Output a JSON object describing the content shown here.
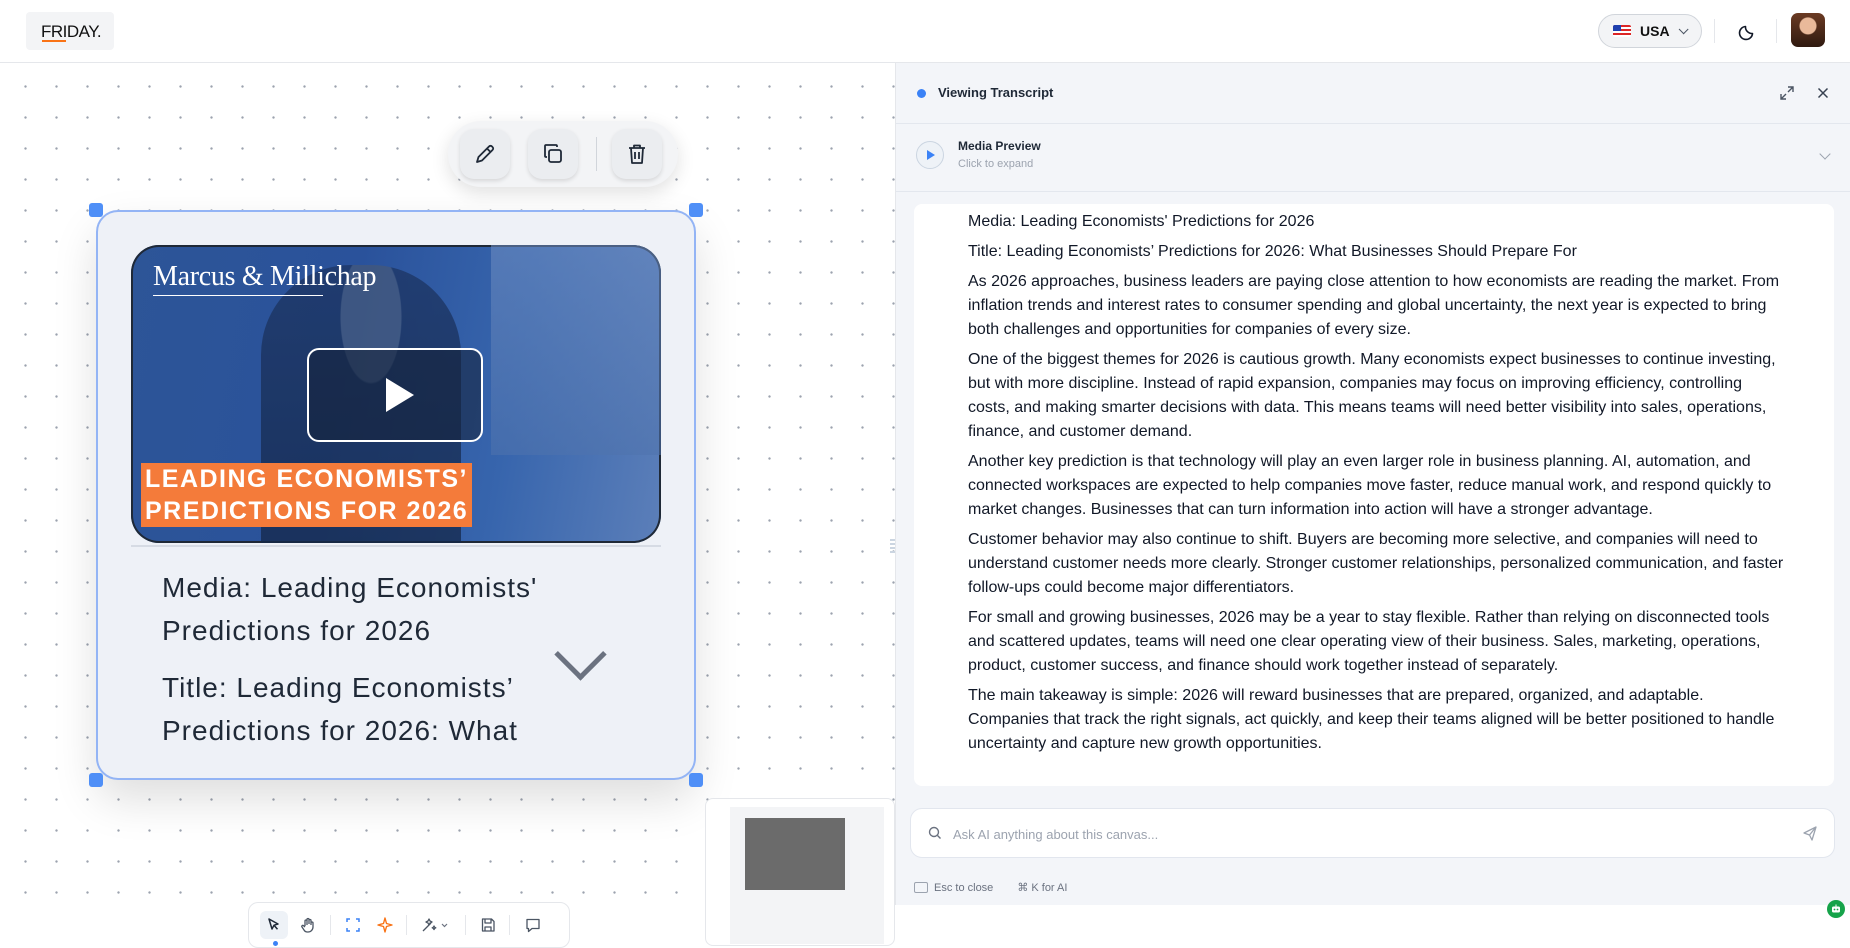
{
  "app": {
    "logo_text": "FRIDAY.",
    "country_label": "USA"
  },
  "canvas": {
    "card": {
      "brand_text": "Marcus & Millichap",
      "banner_line1": "LEADING ECONOMISTS’",
      "banner_line2": "PREDICTIONS FOR 2026",
      "media_line": "Media: Leading Economists' Predictions for 2026",
      "title_line": "Title: Leading Economists’ Predictions for 2026: What"
    }
  },
  "panel": {
    "title": "Viewing Transcript",
    "media_preview": {
      "title": "Media Preview",
      "subtitle": "Click to expand"
    },
    "transcript": [
      "Media: Leading Economists' Predictions for 2026",
      "Title: Leading Economists’ Predictions for 2026: What Businesses Should Prepare For",
      "As 2026 approaches, business leaders are paying close attention to how economists are reading the market. From inflation trends and interest rates to consumer spending and global uncertainty, the next year is expected to bring both challenges and opportunities for companies of every size.",
      "One of the biggest themes for 2026 is cautious growth. Many economists expect businesses to continue investing, but with more discipline. Instead of rapid expansion, companies may focus on improving efficiency, controlling costs, and making smarter decisions with data. This means teams will need better visibility into sales, operations, finance, and customer demand.",
      "Another key prediction is that technology will play an even larger role in business planning. AI, automation, and connected workspaces are expected to help companies move faster, reduce manual work, and respond quickly to market changes. Businesses that can turn information into action will have a stronger advantage.",
      "Customer behavior may also continue to shift. Buyers are becoming more selective, and companies will need to understand customer needs more clearly. Stronger customer relationships, personalized communication, and faster follow-ups could become major differentiators.",
      "For small and growing businesses, 2026 may be a year to stay flexible. Rather than relying on disconnected tools and scattered updates, teams will need one clear operating view of their business. Sales, marketing, operations, product, customer success, and finance should work together instead of separately.",
      "The main takeaway is simple: 2026 will reward businesses that are prepared, organized, and adaptable. Companies that track the right signals, act quickly, and keep their teams aligned will be better positioned to handle uncertainty and capture new growth opportunities."
    ],
    "ask": {
      "value": "",
      "placeholder": "Ask AI anything about this canvas..."
    },
    "hints": {
      "esc": "Esc to close",
      "ai": "⌘ K for AI"
    }
  },
  "colors": {
    "accent": "#3b82f6",
    "selection": "#4f8ff7",
    "banner": "#f47b3a",
    "video_bg": "#2d5597"
  },
  "icons": [
    "pencil-icon",
    "copy-icon",
    "trash-icon",
    "pointer-icon",
    "hand-icon",
    "frame-icon",
    "sparkle-icon",
    "magic-wand-icon",
    "save-icon",
    "comment-icon",
    "moon-icon",
    "expand-icon",
    "close-icon",
    "search-icon",
    "send-icon",
    "play-icon",
    "chevron-down-icon"
  ]
}
